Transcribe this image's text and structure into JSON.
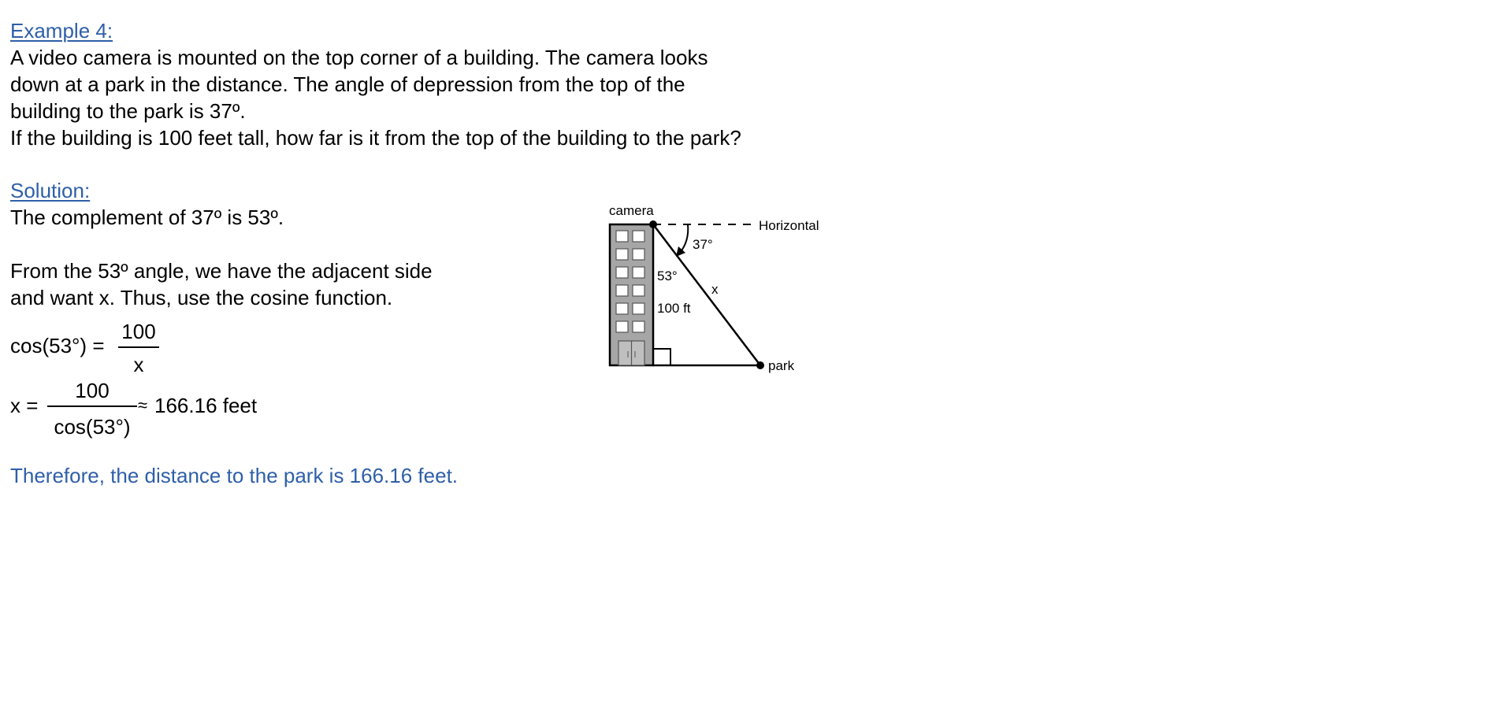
{
  "example": {
    "heading": "Example 4:",
    "lines": [
      "A video camera is mounted on the top corner of a building.  The camera looks",
      "down at a park in the distance.  The angle of depression from the top of the",
      "building to the park is 37º.",
      "If the building is 100 feet tall, how far is it from the top of the building to the park?"
    ]
  },
  "solution": {
    "heading": "Solution:",
    "complement_line": "The complement of 37º is 53º.",
    "reason_lines": [
      "From the 53º angle, we have the adjacent side",
      "and want x.  Thus, use the cosine function."
    ],
    "eq1": {
      "lhs": "cos(53°) =",
      "numerator": "100",
      "denominator": "x"
    },
    "eq2": {
      "lhs": "x =",
      "numerator": "100",
      "denominator": "cos(53°)",
      "approx": "≈",
      "result": "166.16  feet"
    },
    "conclusion": "Therefore, the distance to the park is 166.16 feet."
  },
  "diagram": {
    "camera_label": "camera",
    "horizontal_label": "Horizontal",
    "depression_angle": "37°",
    "top_angle": "53°",
    "hypotenuse_label": "x",
    "height_label": "100 ft",
    "park_label": "park"
  },
  "colors": {
    "heading": "#2e5fa8",
    "building_fill": "#a6a6a6"
  }
}
